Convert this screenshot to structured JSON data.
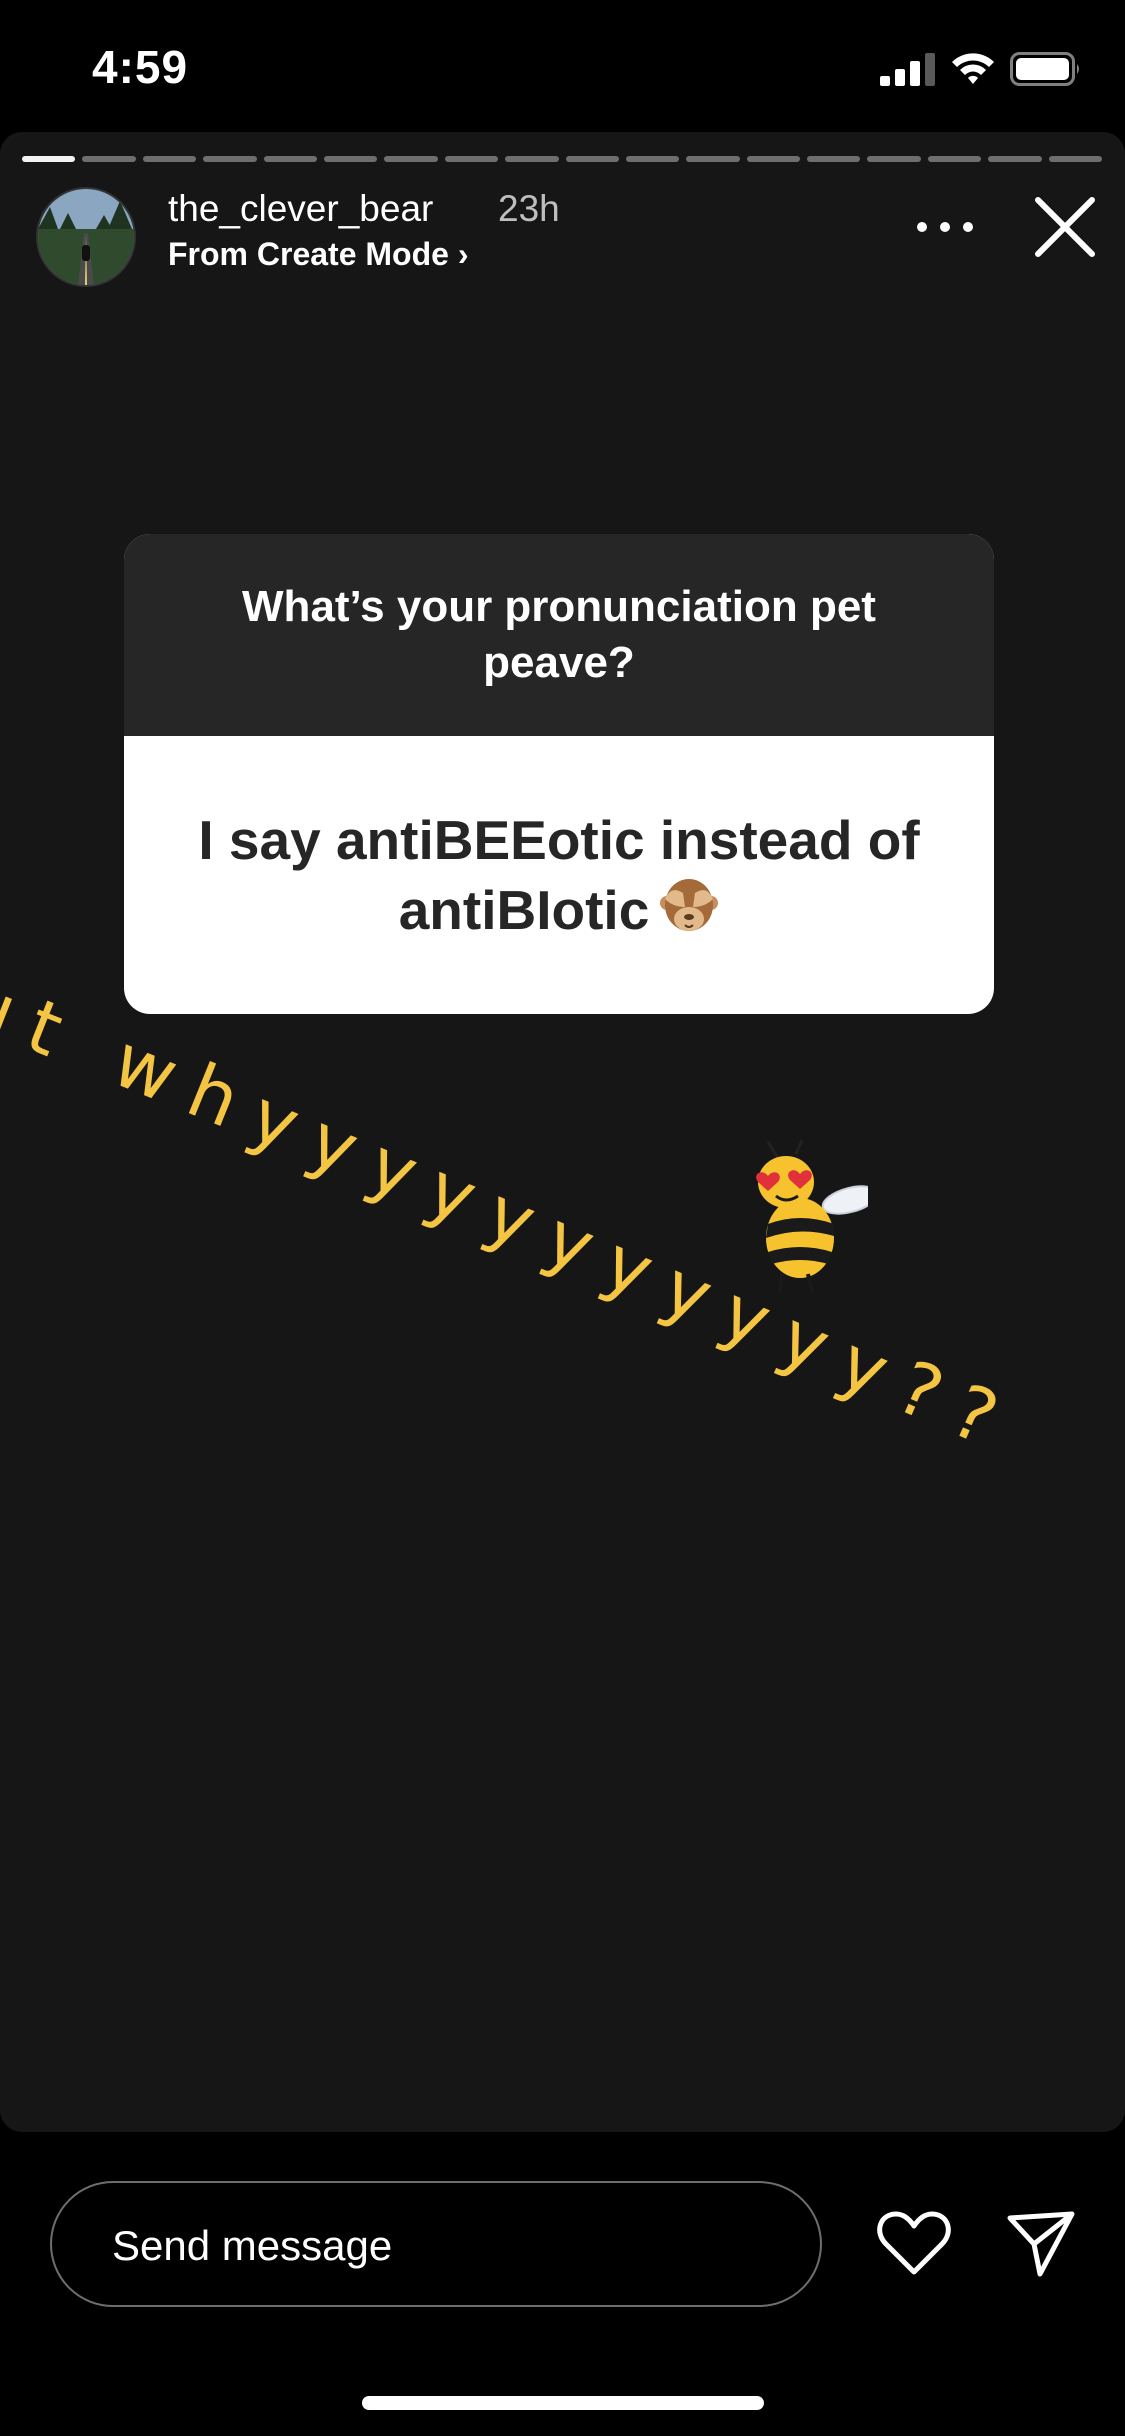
{
  "status_bar": {
    "time": "4:59",
    "icons": [
      "cellular-signal-icon",
      "wifi-icon",
      "battery-icon"
    ]
  },
  "story": {
    "segments_total": 18,
    "segments_viewed": 1,
    "username": "the_clever_bear",
    "timestamp": "23h",
    "subtitle": "From Create Mode ›",
    "accent_color": "#f4c542",
    "question": "What’s your pronunciation pet peave?",
    "answer": "I say antiBEEotic instead of antiBIotic",
    "answer_emoji": "see-no-evil-monkey-icon",
    "diagonal_text": "ut whyyyyyyyyyyy??",
    "sticker": "bee-sticker-icon"
  },
  "footer": {
    "message_placeholder": "Send message",
    "icons": [
      "heart-icon",
      "send-icon"
    ]
  }
}
